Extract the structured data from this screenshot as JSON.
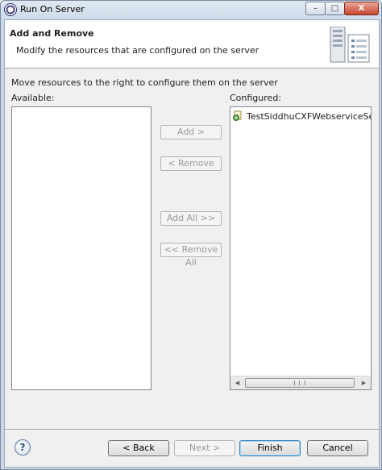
{
  "window": {
    "title": "Run On Server",
    "minimize": "–",
    "maximize": "□",
    "close": "X"
  },
  "banner": {
    "title": "Add and Remove",
    "description": "Modify the resources that are configured on the server",
    "icon": "server-page-icon"
  },
  "instruction": "Move resources to the right to configure them on the server",
  "available": {
    "label": "Available:",
    "items": []
  },
  "configured": {
    "label": "Configured:",
    "items": [
      {
        "label": "TestSiddhuCXFWebserviceSer",
        "icon": "web-project-icon"
      }
    ],
    "scroll_left": "◀",
    "scroll_right": "▶"
  },
  "buttons": {
    "add": "Add >",
    "remove": "< Remove",
    "add_all": "Add All >>",
    "remove_all": "<< Remove All",
    "back": "< Back",
    "next": "Next >",
    "finish": "Finish",
    "cancel": "Cancel",
    "help": "?"
  },
  "colors": {
    "default_button_border": "#3c7fb1",
    "disabled_text": "#9a9a9a"
  }
}
